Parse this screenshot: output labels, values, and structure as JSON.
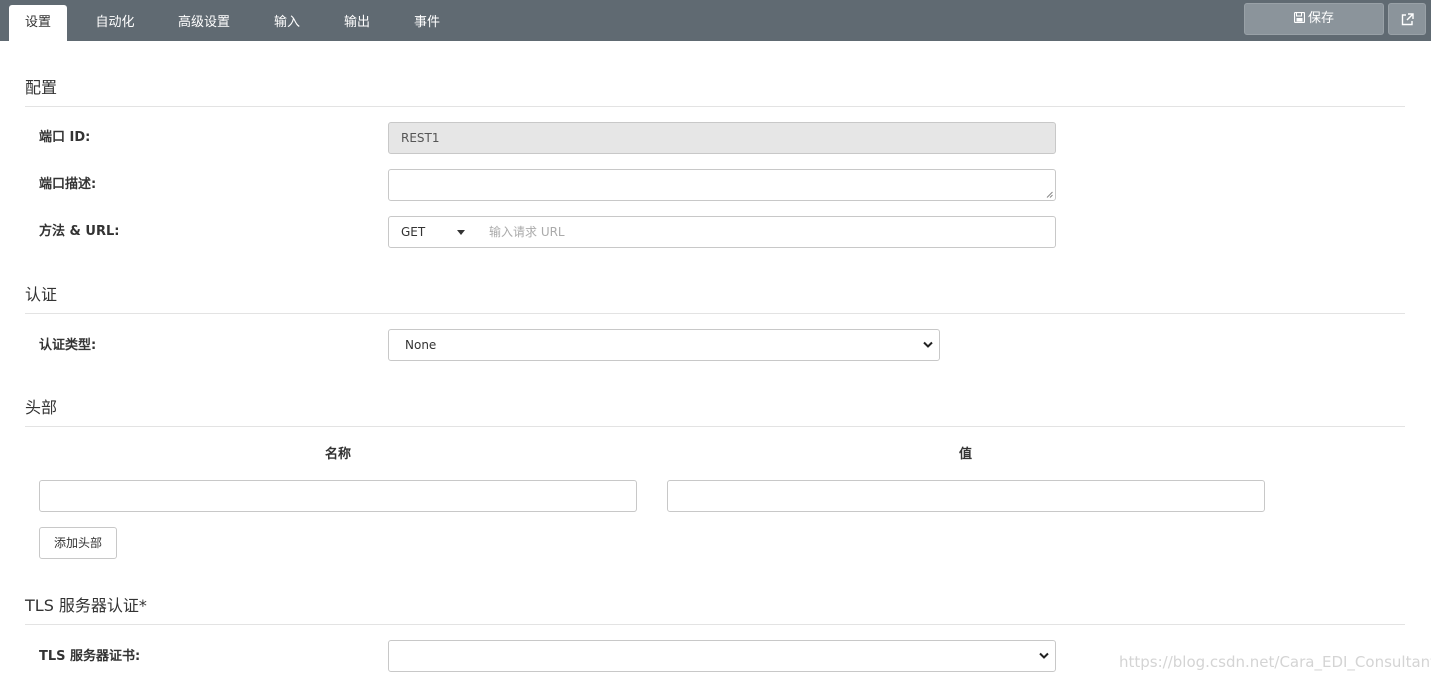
{
  "tabs": [
    {
      "label": "设置",
      "active": true
    },
    {
      "label": "自动化",
      "active": false
    },
    {
      "label": "高级设置",
      "active": false
    },
    {
      "label": "输入",
      "active": false
    },
    {
      "label": "输出",
      "active": false
    },
    {
      "label": "事件",
      "active": false
    }
  ],
  "toolbar": {
    "save_label": "保存",
    "save_icon": "floppy-disk-icon",
    "external_icon": "external-link-icon"
  },
  "config": {
    "title": "配置",
    "port_id_label": "端口 ID:",
    "port_id_value": "REST1",
    "port_desc_label": "端口描述:",
    "port_desc_value": "",
    "method_url_label": "方法 & URL:",
    "method_value": "GET",
    "url_value": "",
    "url_placeholder": "输入请求 URL"
  },
  "auth": {
    "title": "认证",
    "type_label": "认证类型:",
    "type_value": "None"
  },
  "headers": {
    "title": "头部",
    "col_name": "名称",
    "col_value": "值",
    "row_name_value": "",
    "row_value_value": "",
    "add_button_label": "添加头部"
  },
  "tls": {
    "title": "TLS 服务器认证*",
    "cert_label": "TLS 服务器证书:",
    "cert_value": ""
  },
  "watermark": "https://blog.csdn.net/Cara_EDI_Consultant",
  "colors": {
    "topbar_bg": "#606a72",
    "button_bg": "#8b949b"
  }
}
